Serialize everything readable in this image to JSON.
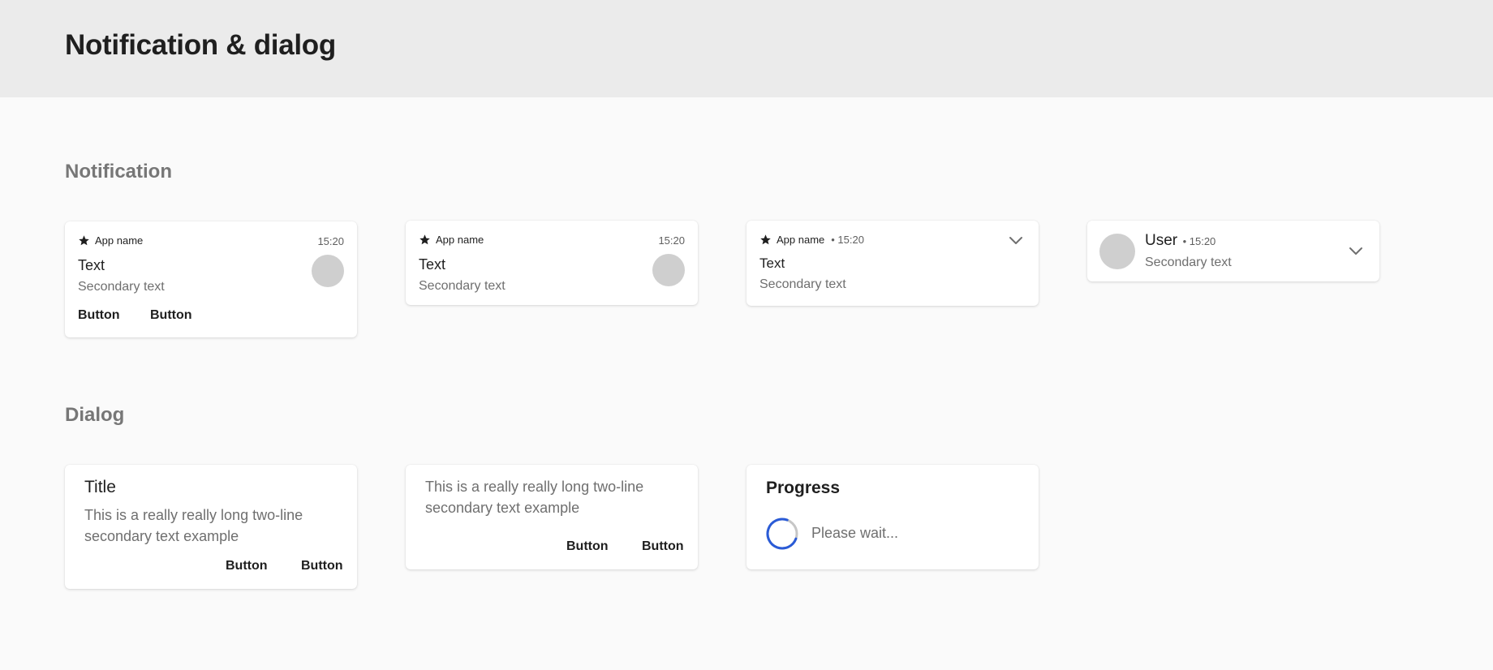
{
  "header": {
    "title": "Notification & dialog"
  },
  "notification_section": {
    "title": "Notification",
    "cards": [
      {
        "app_name": "App name",
        "time": "15:20",
        "text": "Text",
        "secondary": "Secondary text",
        "buttons": [
          "Button",
          "Button"
        ]
      },
      {
        "app_name": "App name",
        "time": "15:20",
        "text": "Text",
        "secondary": "Secondary text"
      },
      {
        "app_name": "App name",
        "time": "• 15:20",
        "text": "Text",
        "secondary": "Secondary text"
      },
      {
        "user": "User",
        "time": "• 15:20",
        "secondary": "Secondary text"
      }
    ]
  },
  "dialog_section": {
    "title": "Dialog",
    "cards": [
      {
        "title": "Title",
        "body": "This is a really really long two-line secondary text example",
        "buttons": [
          "Button",
          "Button"
        ]
      },
      {
        "body": "This is a really really long two-line secondary text example",
        "buttons": [
          "Button",
          "Button"
        ]
      },
      {
        "title": "Progress",
        "status": "Please wait..."
      }
    ]
  },
  "colors": {
    "header_bg": "#ebebeb",
    "page_bg": "#fafafa",
    "avatar": "#cfcfcf",
    "spinner_accent": "#2a5bd7",
    "spinner_track": "#c6c6c6"
  },
  "icons": [
    "star-icon",
    "chevron-down-icon",
    "progress-spinner-icon"
  ]
}
